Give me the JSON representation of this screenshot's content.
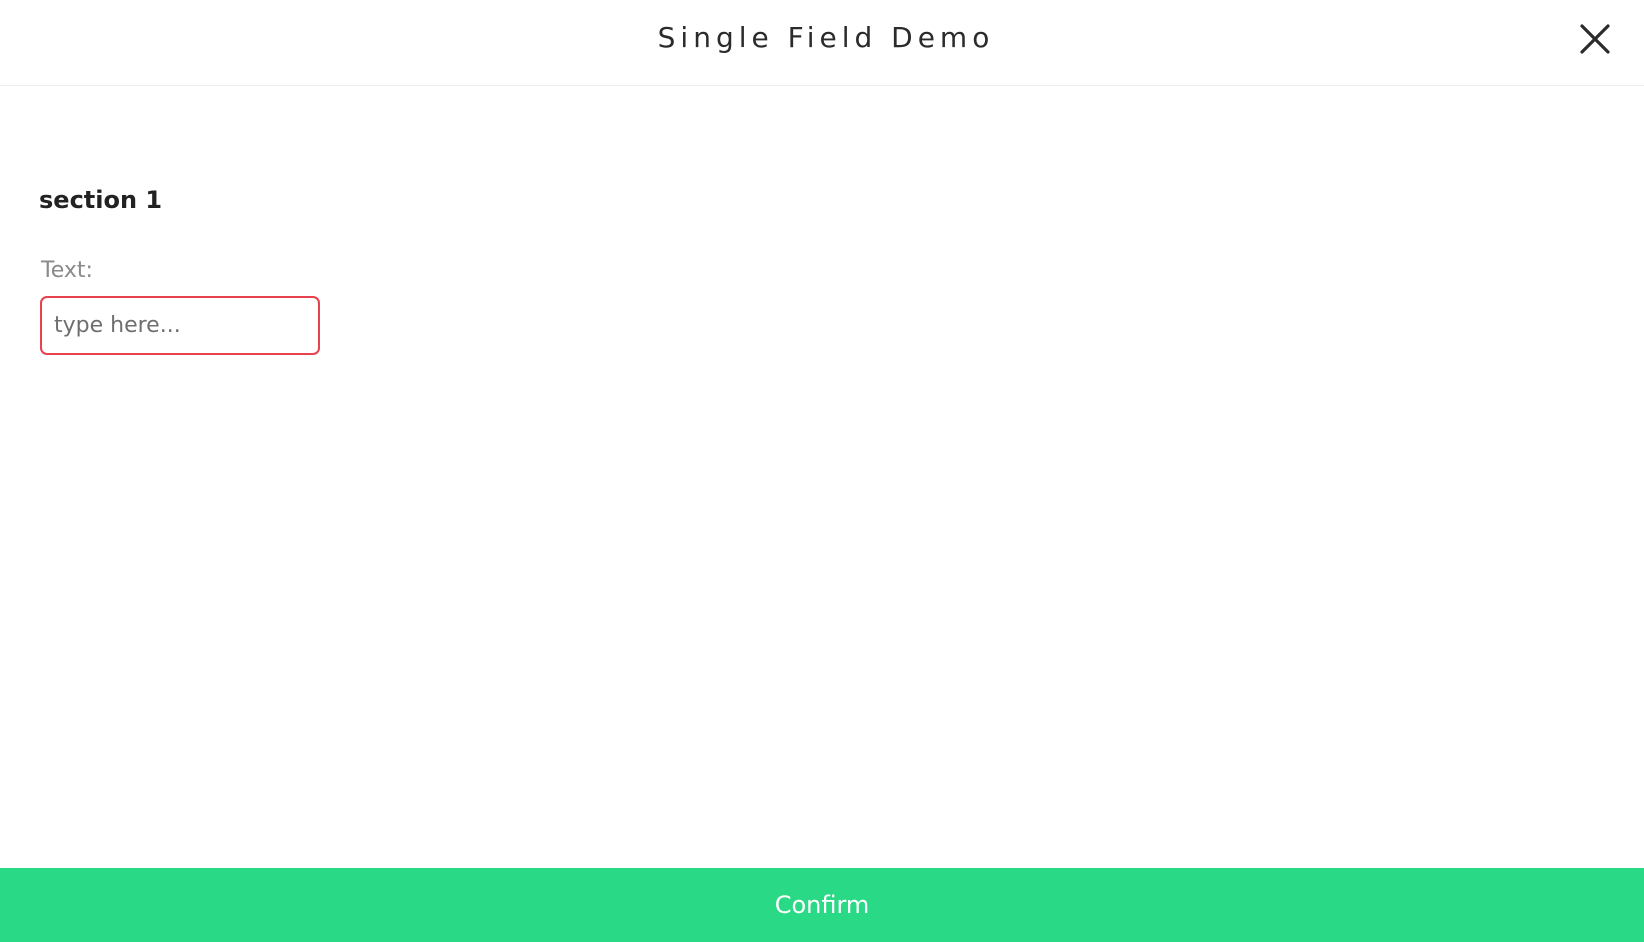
{
  "header": {
    "title": "Single Field Demo",
    "close_icon": "close-icon"
  },
  "form": {
    "section_title": "section 1",
    "text_field": {
      "label": "Text:",
      "value": "",
      "placeholder": "type here..."
    }
  },
  "footer": {
    "confirm_label": "Confirm"
  },
  "colors": {
    "accent": "#2ad986",
    "input_error_border": "#e8424f",
    "title_text": "#2b2b2b",
    "label_text": "#8a8a8a"
  }
}
